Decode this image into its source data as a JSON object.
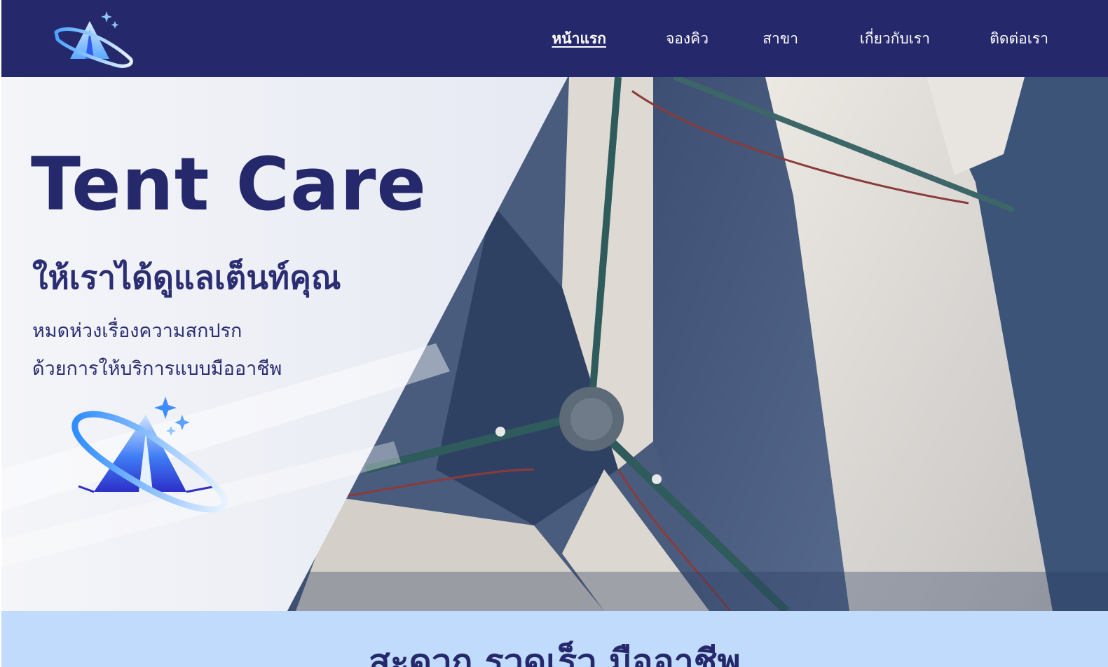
{
  "brand": {
    "name": "Tent Care"
  },
  "nav": {
    "items": [
      {
        "label": "หน้าแรก",
        "active": true
      },
      {
        "label": "จองคิว",
        "active": false
      },
      {
        "label": "สาขา",
        "active": false
      },
      {
        "label": "เกี่ยวกับเรา",
        "active": false
      },
      {
        "label": "ติดต่อเรา",
        "active": false
      }
    ]
  },
  "hero": {
    "title": "Tent Care",
    "subtitle": "ให้เราได้ดูแลเต็นท์คุณ",
    "desc_line1": "หมดห่วงเรื่องความสกปรก",
    "desc_line2": "ด้วยการให้บริการแบบมืออาชีพ"
  },
  "band": {
    "title": "สะดวก รวดเร็ว มืออาชีพ"
  },
  "colors": {
    "navbar": "#26286c",
    "heading": "#26286c",
    "band": "#c0dbfb",
    "logo_blue": "#2f5cf0",
    "logo_light": "#8fc6ff"
  },
  "icons": [
    "tent-logo-icon",
    "sparkle-icon"
  ]
}
